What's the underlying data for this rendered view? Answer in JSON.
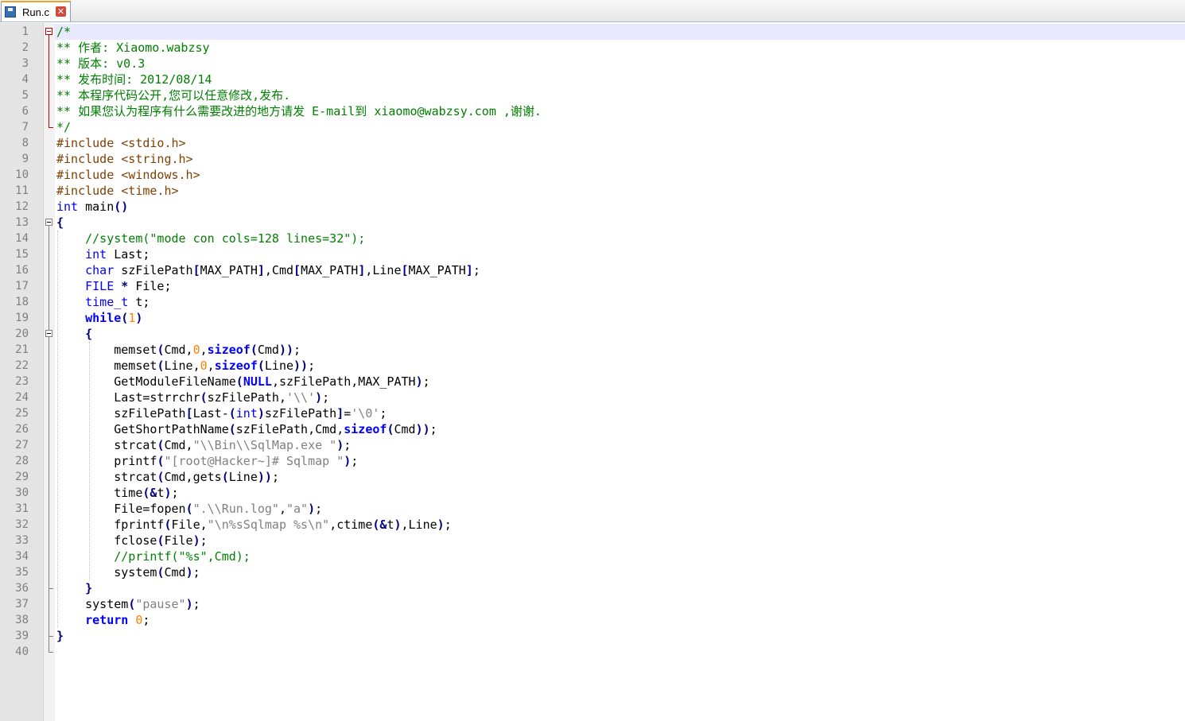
{
  "tab": {
    "label": "Run.c",
    "close_glyph": "✕",
    "icon": "save-disk-icon"
  },
  "colors": {
    "comment": "#008000",
    "preprocessor": "#804000",
    "keyword": "#0000ff",
    "number": "#ff8000",
    "string": "#808080",
    "operator": "#000080",
    "current_line": "#e8e8ff"
  },
  "line_numbers": [
    "1",
    "2",
    "3",
    "4",
    "5",
    "6",
    "7",
    "8",
    "9",
    "10",
    "11",
    "12",
    "13",
    "14",
    "15",
    "16",
    "17",
    "18",
    "19",
    "20",
    "21",
    "22",
    "23",
    "24",
    "25",
    "26",
    "27",
    "28",
    "29",
    "30",
    "31",
    "32",
    "33",
    "34",
    "35",
    "36",
    "37",
    "38",
    "39",
    "40"
  ],
  "code_lines": [
    [
      {
        "t": "/*",
        "c": "cm"
      }
    ],
    [
      {
        "t": "** 作者: Xiaomo.wabzsy",
        "c": "cm"
      }
    ],
    [
      {
        "t": "** 版本: v0.3",
        "c": "cm"
      }
    ],
    [
      {
        "t": "** 发布时间: 2012/08/14",
        "c": "cm"
      }
    ],
    [
      {
        "t": "** 本程序代码公开,您可以任意修改,发布.",
        "c": "cm"
      }
    ],
    [
      {
        "t": "** 如果您认为程序有什么需要改进的地方请发 E-mail到 xiaomo@wabzsy.com ,谢谢.",
        "c": "cm"
      }
    ],
    [
      {
        "t": "*/",
        "c": "cm"
      }
    ],
    [
      {
        "t": "#include <stdio.h>",
        "c": "pp"
      }
    ],
    [
      {
        "t": "#include <string.h>",
        "c": "pp"
      }
    ],
    [
      {
        "t": "#include <windows.h>",
        "c": "pp"
      }
    ],
    [
      {
        "t": "#include <time.h>",
        "c": "pp"
      }
    ],
    [
      {
        "t": "int",
        "c": "kw"
      },
      {
        "t": " main",
        "c": ""
      },
      {
        "t": "()",
        "c": "op"
      }
    ],
    [
      {
        "t": "{",
        "c": "op"
      }
    ],
    [
      {
        "t": "    ",
        "c": ""
      },
      {
        "t": "//system(\"mode con cols=128 lines=32\");",
        "c": "cm"
      }
    ],
    [
      {
        "t": "    ",
        "c": ""
      },
      {
        "t": "int",
        "c": "kw"
      },
      {
        "t": " Last;",
        "c": ""
      }
    ],
    [
      {
        "t": "    ",
        "c": ""
      },
      {
        "t": "char",
        "c": "kw"
      },
      {
        "t": " szFilePath",
        "c": ""
      },
      {
        "t": "[",
        "c": "op"
      },
      {
        "t": "MAX_PATH",
        "c": ""
      },
      {
        "t": "]",
        "c": "op"
      },
      {
        "t": ",Cmd",
        "c": ""
      },
      {
        "t": "[",
        "c": "op"
      },
      {
        "t": "MAX_PATH",
        "c": ""
      },
      {
        "t": "]",
        "c": "op"
      },
      {
        "t": ",Line",
        "c": ""
      },
      {
        "t": "[",
        "c": "op"
      },
      {
        "t": "MAX_PATH",
        "c": ""
      },
      {
        "t": "]",
        "c": "op"
      },
      {
        "t": ";",
        "c": ""
      }
    ],
    [
      {
        "t": "    ",
        "c": ""
      },
      {
        "t": "FILE",
        "c": "kw"
      },
      {
        "t": " ",
        "c": ""
      },
      {
        "t": "*",
        "c": "op"
      },
      {
        "t": " File;",
        "c": ""
      }
    ],
    [
      {
        "t": "    ",
        "c": ""
      },
      {
        "t": "time_t",
        "c": "kw"
      },
      {
        "t": " t;",
        "c": ""
      }
    ],
    [
      {
        "t": "    ",
        "c": ""
      },
      {
        "t": "while",
        "c": "kwb"
      },
      {
        "t": "(",
        "c": "op"
      },
      {
        "t": "1",
        "c": "num"
      },
      {
        "t": ")",
        "c": "op"
      }
    ],
    [
      {
        "t": "    ",
        "c": ""
      },
      {
        "t": "{",
        "c": "op"
      }
    ],
    [
      {
        "t": "        memset",
        "c": ""
      },
      {
        "t": "(",
        "c": "op"
      },
      {
        "t": "Cmd,",
        "c": ""
      },
      {
        "t": "0",
        "c": "num"
      },
      {
        "t": ",",
        "c": ""
      },
      {
        "t": "sizeof",
        "c": "kwb"
      },
      {
        "t": "(",
        "c": "op"
      },
      {
        "t": "Cmd",
        "c": ""
      },
      {
        "t": "))",
        "c": "op"
      },
      {
        "t": ";",
        "c": ""
      }
    ],
    [
      {
        "t": "        memset",
        "c": ""
      },
      {
        "t": "(",
        "c": "op"
      },
      {
        "t": "Line,",
        "c": ""
      },
      {
        "t": "0",
        "c": "num"
      },
      {
        "t": ",",
        "c": ""
      },
      {
        "t": "sizeof",
        "c": "kwb"
      },
      {
        "t": "(",
        "c": "op"
      },
      {
        "t": "Line",
        "c": ""
      },
      {
        "t": "))",
        "c": "op"
      },
      {
        "t": ";",
        "c": ""
      }
    ],
    [
      {
        "t": "        GetModuleFileName",
        "c": ""
      },
      {
        "t": "(",
        "c": "op"
      },
      {
        "t": "NULL",
        "c": "kwb"
      },
      {
        "t": ",szFilePath,MAX_PATH",
        "c": ""
      },
      {
        "t": ")",
        "c": "op"
      },
      {
        "t": ";",
        "c": ""
      }
    ],
    [
      {
        "t": "        Last=strrchr",
        "c": ""
      },
      {
        "t": "(",
        "c": "op"
      },
      {
        "t": "szFilePath,",
        "c": ""
      },
      {
        "t": "'\\\\'",
        "c": "str"
      },
      {
        "t": ")",
        "c": "op"
      },
      {
        "t": ";",
        "c": ""
      }
    ],
    [
      {
        "t": "        szFilePath",
        "c": ""
      },
      {
        "t": "[",
        "c": "op"
      },
      {
        "t": "Last-",
        "c": ""
      },
      {
        "t": "(",
        "c": "op"
      },
      {
        "t": "int",
        "c": "kw"
      },
      {
        "t": ")",
        "c": "op"
      },
      {
        "t": "szFilePath",
        "c": ""
      },
      {
        "t": "]",
        "c": "op"
      },
      {
        "t": "=",
        "c": ""
      },
      {
        "t": "'\\0'",
        "c": "str"
      },
      {
        "t": ";",
        "c": ""
      }
    ],
    [
      {
        "t": "        GetShortPathName",
        "c": ""
      },
      {
        "t": "(",
        "c": "op"
      },
      {
        "t": "szFilePath,Cmd,",
        "c": ""
      },
      {
        "t": "sizeof",
        "c": "kwb"
      },
      {
        "t": "(",
        "c": "op"
      },
      {
        "t": "Cmd",
        "c": ""
      },
      {
        "t": "))",
        "c": "op"
      },
      {
        "t": ";",
        "c": ""
      }
    ],
    [
      {
        "t": "        strcat",
        "c": ""
      },
      {
        "t": "(",
        "c": "op"
      },
      {
        "t": "Cmd,",
        "c": ""
      },
      {
        "t": "\"\\\\Bin\\\\SqlMap.exe \"",
        "c": "str"
      },
      {
        "t": ")",
        "c": "op"
      },
      {
        "t": ";",
        "c": ""
      }
    ],
    [
      {
        "t": "        printf",
        "c": ""
      },
      {
        "t": "(",
        "c": "op"
      },
      {
        "t": "\"[root@Hacker~]# Sqlmap \"",
        "c": "str"
      },
      {
        "t": ")",
        "c": "op"
      },
      {
        "t": ";",
        "c": ""
      }
    ],
    [
      {
        "t": "        strcat",
        "c": ""
      },
      {
        "t": "(",
        "c": "op"
      },
      {
        "t": "Cmd,gets",
        "c": ""
      },
      {
        "t": "(",
        "c": "op"
      },
      {
        "t": "Line",
        "c": ""
      },
      {
        "t": "))",
        "c": "op"
      },
      {
        "t": ";",
        "c": ""
      }
    ],
    [
      {
        "t": "        time",
        "c": ""
      },
      {
        "t": "(&",
        "c": "op"
      },
      {
        "t": "t",
        "c": ""
      },
      {
        "t": ")",
        "c": "op"
      },
      {
        "t": ";",
        "c": ""
      }
    ],
    [
      {
        "t": "        File=fopen",
        "c": ""
      },
      {
        "t": "(",
        "c": "op"
      },
      {
        "t": "\".\\\\Run.log\"",
        "c": "str"
      },
      {
        "t": ",",
        "c": ""
      },
      {
        "t": "\"a\"",
        "c": "str"
      },
      {
        "t": ")",
        "c": "op"
      },
      {
        "t": ";",
        "c": ""
      }
    ],
    [
      {
        "t": "        fprintf",
        "c": ""
      },
      {
        "t": "(",
        "c": "op"
      },
      {
        "t": "File,",
        "c": ""
      },
      {
        "t": "\"\\n%sSqlmap %s\\n\"",
        "c": "str"
      },
      {
        "t": ",ctime",
        "c": ""
      },
      {
        "t": "(&",
        "c": "op"
      },
      {
        "t": "t",
        "c": ""
      },
      {
        "t": ")",
        "c": "op"
      },
      {
        "t": ",Line",
        "c": ""
      },
      {
        "t": ")",
        "c": "op"
      },
      {
        "t": ";",
        "c": ""
      }
    ],
    [
      {
        "t": "        fclose",
        "c": ""
      },
      {
        "t": "(",
        "c": "op"
      },
      {
        "t": "File",
        "c": ""
      },
      {
        "t": ")",
        "c": "op"
      },
      {
        "t": ";",
        "c": ""
      }
    ],
    [
      {
        "t": "        ",
        "c": ""
      },
      {
        "t": "//printf(\"%s\",Cmd);",
        "c": "cm"
      }
    ],
    [
      {
        "t": "        system",
        "c": ""
      },
      {
        "t": "(",
        "c": "op"
      },
      {
        "t": "Cmd",
        "c": ""
      },
      {
        "t": ")",
        "c": "op"
      },
      {
        "t": ";",
        "c": ""
      }
    ],
    [
      {
        "t": "    ",
        "c": ""
      },
      {
        "t": "}",
        "c": "op"
      }
    ],
    [
      {
        "t": "    system",
        "c": ""
      },
      {
        "t": "(",
        "c": "op"
      },
      {
        "t": "\"pause\"",
        "c": "str"
      },
      {
        "t": ")",
        "c": "op"
      },
      {
        "t": ";",
        "c": ""
      }
    ],
    [
      {
        "t": "    ",
        "c": ""
      },
      {
        "t": "return",
        "c": "kwb"
      },
      {
        "t": " ",
        "c": ""
      },
      {
        "t": "0",
        "c": "num"
      },
      {
        "t": ";",
        "c": ""
      }
    ],
    [
      {
        "t": "}",
        "c": "op"
      }
    ],
    []
  ]
}
